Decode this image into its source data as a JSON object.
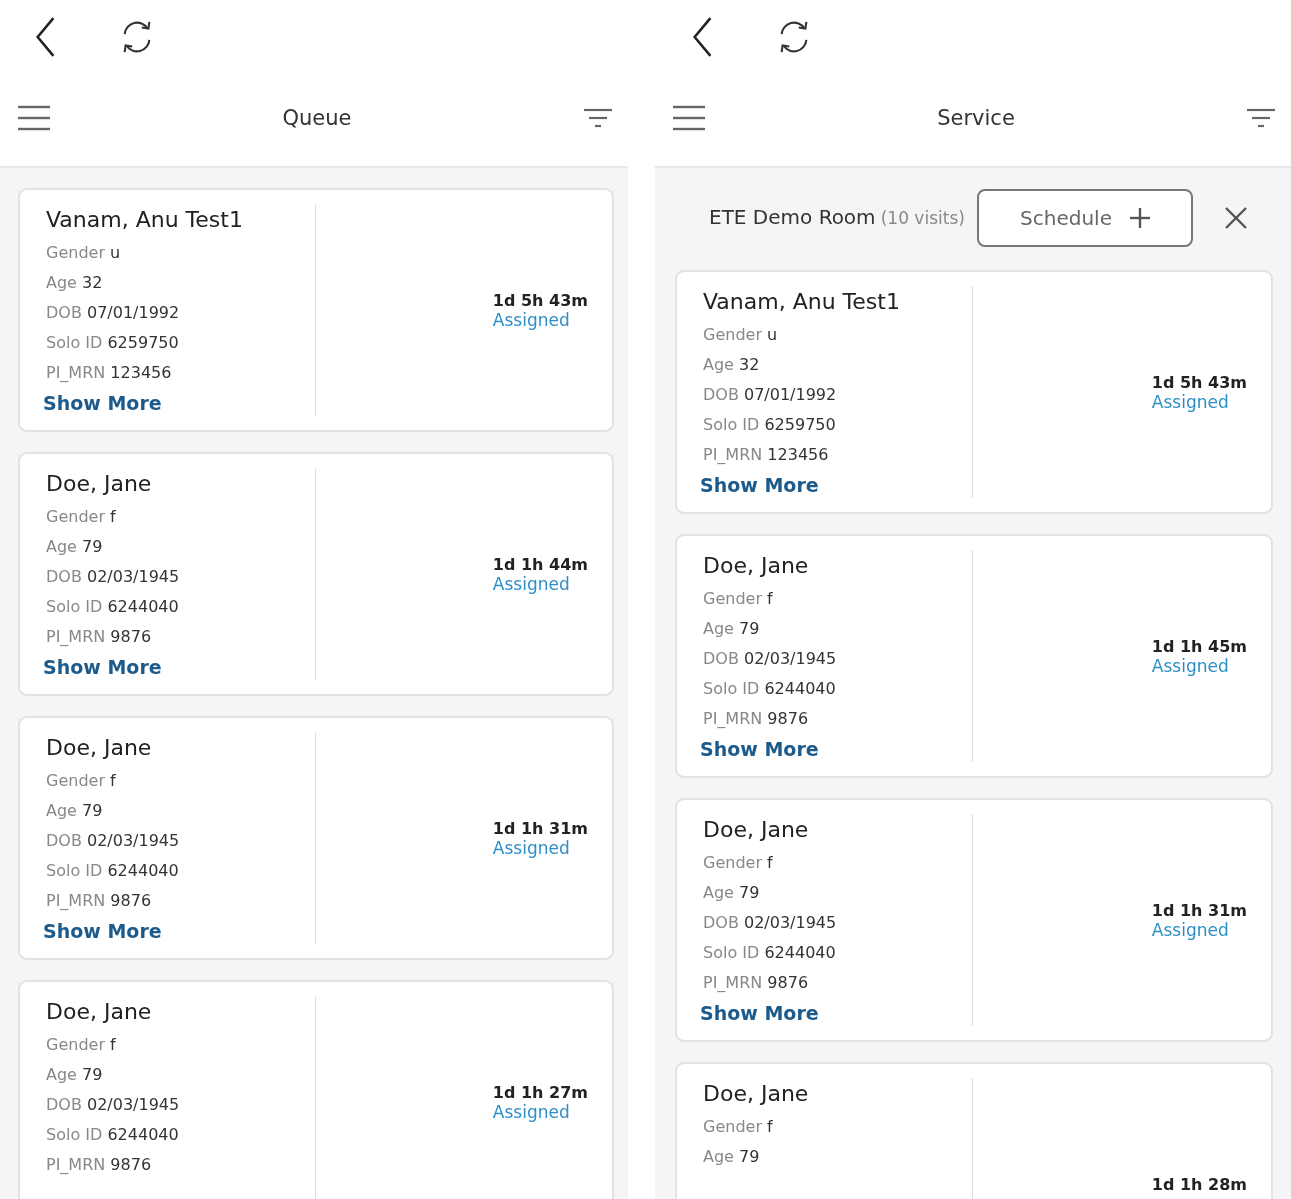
{
  "panes": [
    {
      "title": "Queue",
      "cards": [
        {
          "name": "Vanam, Anu Test1",
          "fields": [
            {
              "label": "Gender",
              "value": "u"
            },
            {
              "label": "Age",
              "value": "32"
            },
            {
              "label": "DOB",
              "value": "07/01/1992"
            },
            {
              "label": "Solo ID",
              "value": "6259750"
            },
            {
              "label": "PI_MRN",
              "value": "123456"
            }
          ],
          "time": "1d 5h 43m",
          "status": "Assigned",
          "link": "Show More"
        },
        {
          "name": "Doe, Jane",
          "fields": [
            {
              "label": "Gender",
              "value": "f"
            },
            {
              "label": "Age",
              "value": "79"
            },
            {
              "label": "DOB",
              "value": "02/03/1945"
            },
            {
              "label": "Solo ID",
              "value": "6244040"
            },
            {
              "label": "PI_MRN",
              "value": "9876"
            }
          ],
          "time": "1d 1h 44m",
          "status": "Assigned",
          "link": "Show More"
        },
        {
          "name": "Doe, Jane",
          "fields": [
            {
              "label": "Gender",
              "value": "f"
            },
            {
              "label": "Age",
              "value": "79"
            },
            {
              "label": "DOB",
              "value": "02/03/1945"
            },
            {
              "label": "Solo ID",
              "value": "6244040"
            },
            {
              "label": "PI_MRN",
              "value": "9876"
            }
          ],
          "time": "1d 1h 31m",
          "status": "Assigned",
          "link": "Show More"
        },
        {
          "name": "Doe, Jane",
          "fields": [
            {
              "label": "Gender",
              "value": "f"
            },
            {
              "label": "Age",
              "value": "79"
            },
            {
              "label": "DOB",
              "value": "02/03/1945"
            },
            {
              "label": "Solo ID",
              "value": "6244040"
            },
            {
              "label": "PI_MRN",
              "value": "9876"
            }
          ],
          "time": "1d 1h 27m",
          "status": "Assigned"
        }
      ]
    },
    {
      "title": "Service",
      "room": {
        "name": "ETE Demo Room",
        "count": "(10 visits)",
        "button": "Schedule"
      },
      "cards": [
        {
          "name": "Vanam, Anu Test1",
          "fields": [
            {
              "label": "Gender",
              "value": "u"
            },
            {
              "label": "Age",
              "value": "32"
            },
            {
              "label": "DOB",
              "value": "07/01/1992"
            },
            {
              "label": "Solo ID",
              "value": "6259750"
            },
            {
              "label": "PI_MRN",
              "value": "123456"
            }
          ],
          "time": "1d 5h 43m",
          "status": "Assigned",
          "link": "Show More"
        },
        {
          "name": "Doe, Jane",
          "fields": [
            {
              "label": "Gender",
              "value": "f"
            },
            {
              "label": "Age",
              "value": "79"
            },
            {
              "label": "DOB",
              "value": "02/03/1945"
            },
            {
              "label": "Solo ID",
              "value": "6244040"
            },
            {
              "label": "PI_MRN",
              "value": "9876"
            }
          ],
          "time": "1d 1h 45m",
          "status": "Assigned",
          "link": "Show More"
        },
        {
          "name": "Doe, Jane",
          "fields": [
            {
              "label": "Gender",
              "value": "f"
            },
            {
              "label": "Age",
              "value": "79"
            },
            {
              "label": "DOB",
              "value": "02/03/1945"
            },
            {
              "label": "Solo ID",
              "value": "6244040"
            },
            {
              "label": "PI_MRN",
              "value": "9876"
            }
          ],
          "time": "1d 1h 31m",
          "status": "Assigned",
          "link": "Show More"
        },
        {
          "name": "Doe, Jane",
          "fields": [
            {
              "label": "Gender",
              "value": "f"
            },
            {
              "label": "Age",
              "value": "79"
            }
          ],
          "time": "1d 1h 28m"
        }
      ]
    }
  ]
}
